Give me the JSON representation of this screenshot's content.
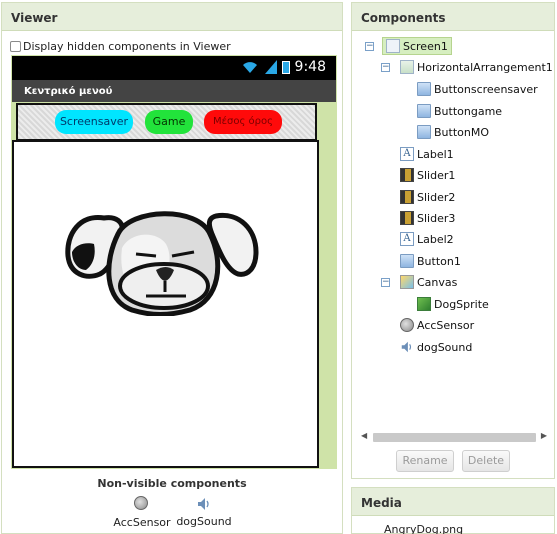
{
  "viewer": {
    "title": "Viewer",
    "hidden_components_label": "Display hidden components in Viewer",
    "status_time": "9:48",
    "screen_title": "Κεντρικό μενού",
    "buttons": {
      "screensaver": "Screensaver",
      "game": "Game",
      "mo": "Μέσος όρος"
    },
    "nonvisible_title": "Non-visible components",
    "nonvisible": [
      {
        "label": "AccSensor",
        "icon": "accelerometer-icon"
      },
      {
        "label": "dogSound",
        "icon": "speaker-icon"
      }
    ]
  },
  "components": {
    "title": "Components",
    "tree": [
      {
        "label": "Screen1",
        "icon": "screen-icon",
        "selected": true
      },
      {
        "label": "HorizontalArrangement1",
        "icon": "horizontal-arrangement-icon"
      },
      {
        "label": "Buttonscreensaver",
        "icon": "button-icon"
      },
      {
        "label": "Buttongame",
        "icon": "button-icon"
      },
      {
        "label": "ButtonMO",
        "icon": "button-icon"
      },
      {
        "label": "Label1",
        "icon": "label-icon"
      },
      {
        "label": "Slider1",
        "icon": "slider-icon"
      },
      {
        "label": "Slider2",
        "icon": "slider-icon"
      },
      {
        "label": "Slider3",
        "icon": "slider-icon"
      },
      {
        "label": "Label2",
        "icon": "label-icon"
      },
      {
        "label": "Button1",
        "icon": "button-icon"
      },
      {
        "label": "Canvas",
        "icon": "canvas-icon"
      },
      {
        "label": "DogSprite",
        "icon": "image-sprite-icon"
      },
      {
        "label": "AccSensor",
        "icon": "accelerometer-icon"
      },
      {
        "label": "dogSound",
        "icon": "speaker-icon"
      }
    ],
    "rename_label": "Rename",
    "delete_label": "Delete"
  },
  "media": {
    "title": "Media",
    "items": [
      "AngryDog.png"
    ]
  },
  "colors": {
    "panel_header": "#e6eedb",
    "button_screensaver": "#00e5ff",
    "button_game": "#22e33b",
    "button_mo": "#ff0a0a",
    "status_bar": "#000000",
    "title_bar": "#444444"
  }
}
